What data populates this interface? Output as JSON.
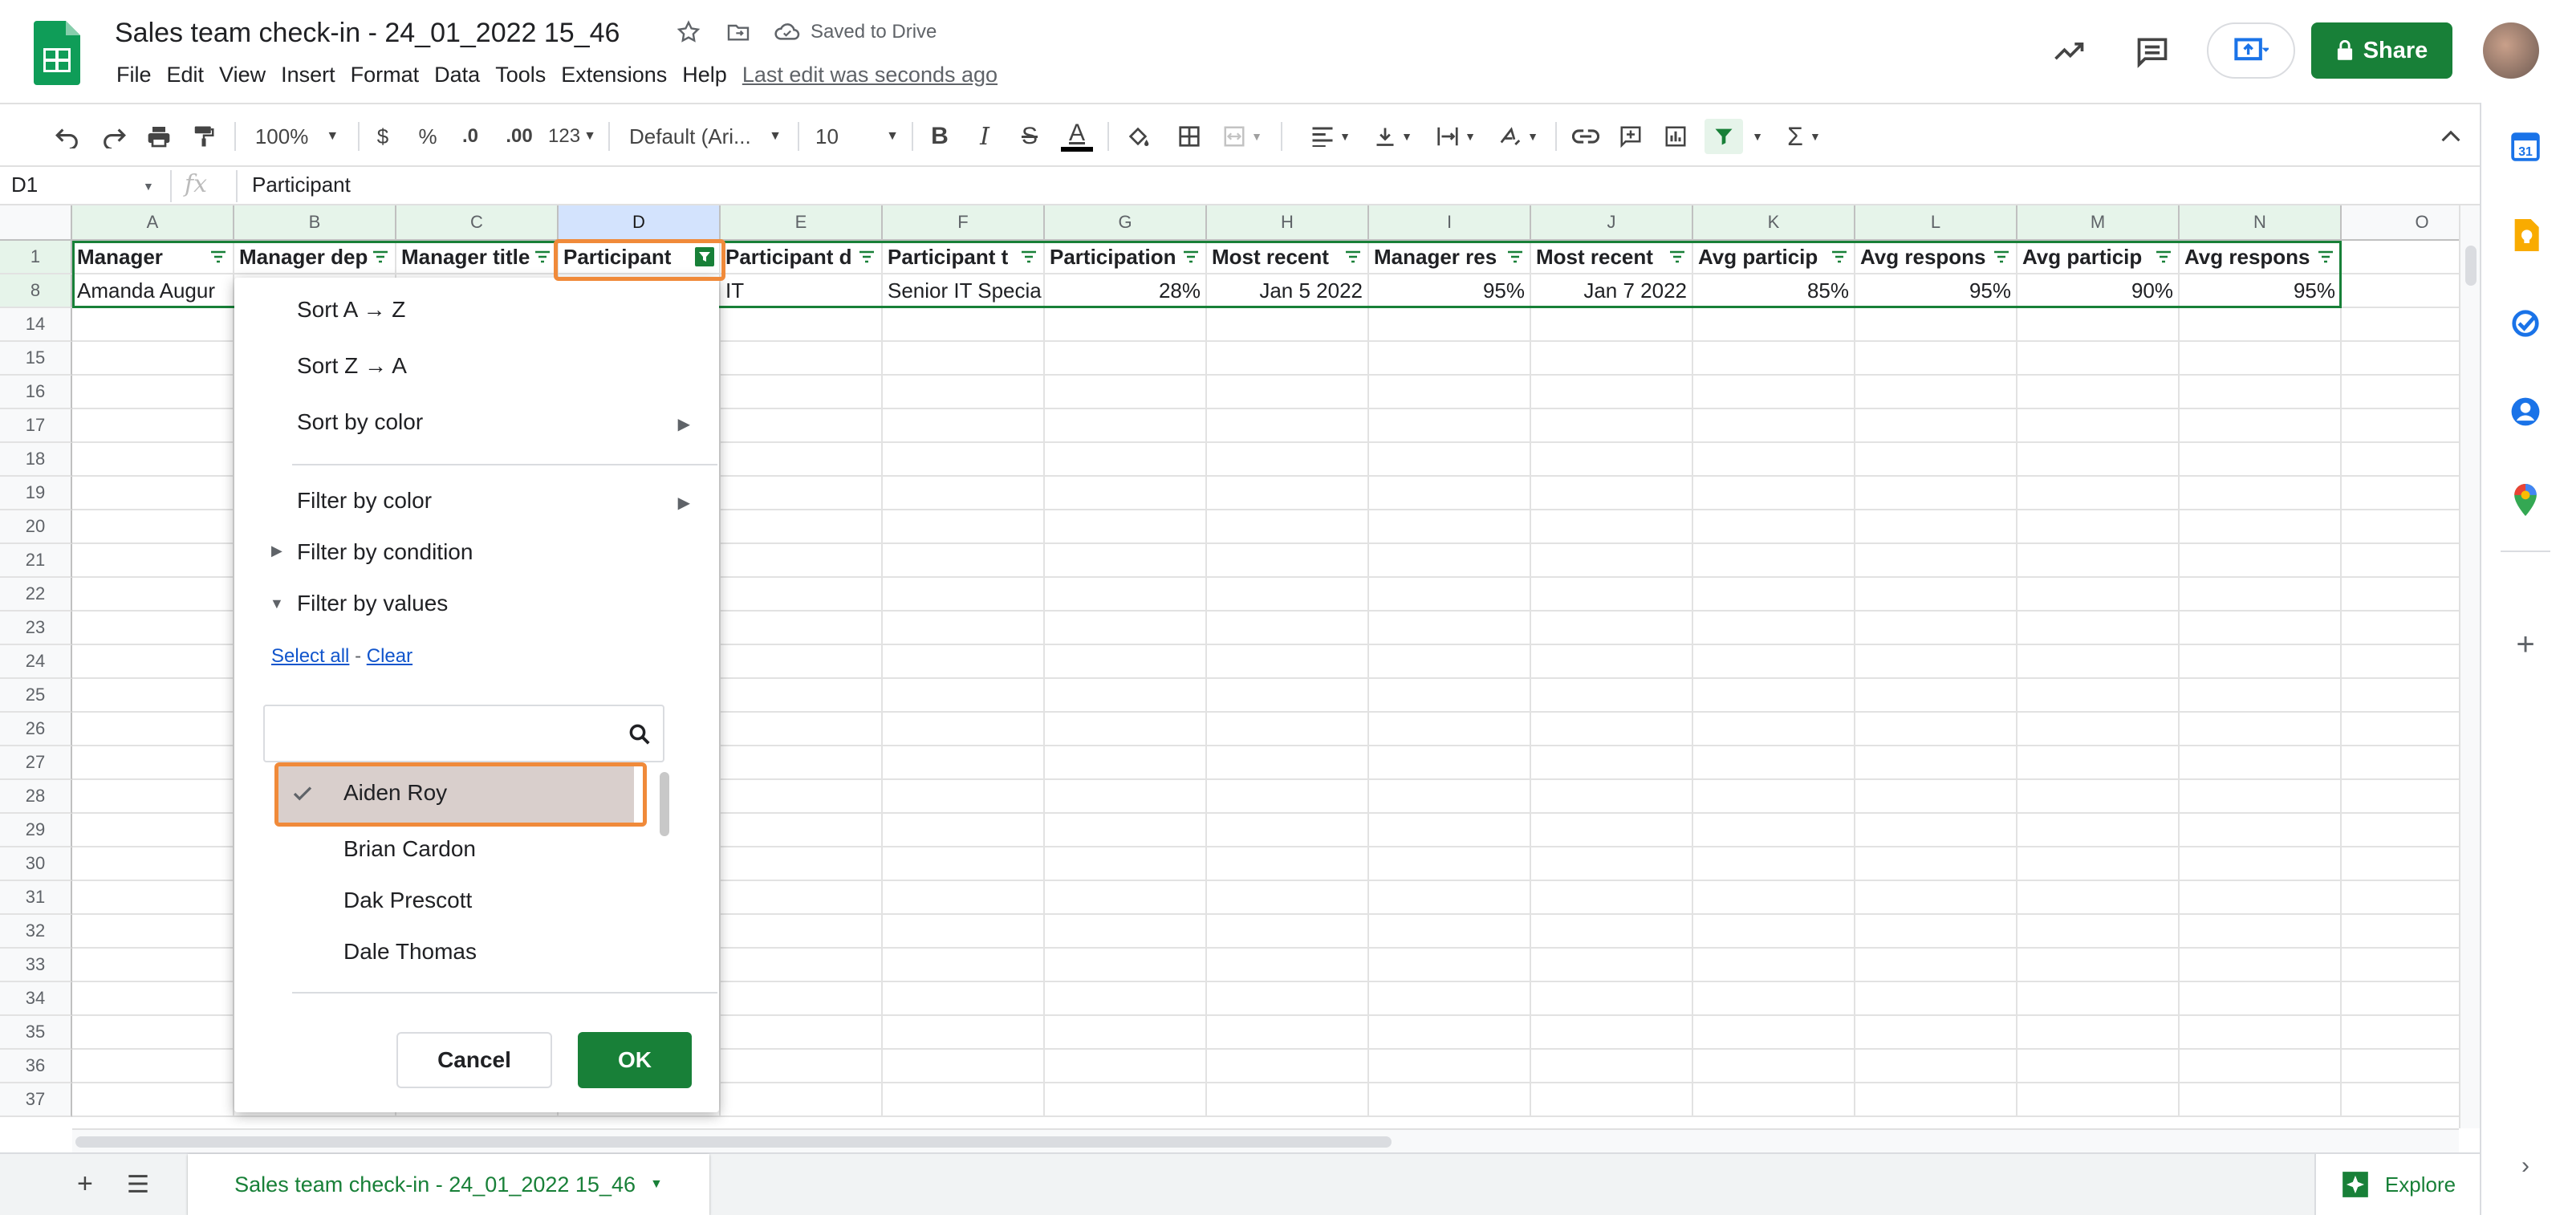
{
  "doc": {
    "title": "Sales team check-in - 24_01_2022 15_46",
    "saved": "Saved to Drive"
  },
  "menu": [
    "File",
    "Edit",
    "View",
    "Insert",
    "Format",
    "Data",
    "Tools",
    "Extensions",
    "Help"
  ],
  "last_edit": "Last edit was seconds ago",
  "share_label": "Share",
  "toolbar": {
    "zoom": "100%",
    "currency": "$",
    "percent": "%",
    "dec_less": ".0",
    "dec_more": ".00",
    "format": "123",
    "font": "Default (Ari...",
    "size": "10",
    "bold": "B",
    "italic": "I",
    "strike": "S",
    "textcolor": "A"
  },
  "formula": {
    "cell": "D1",
    "value": "Participant"
  },
  "columns": [
    "A",
    "B",
    "C",
    "D",
    "E",
    "F",
    "G",
    "H",
    "I",
    "J",
    "K",
    "L",
    "M",
    "N",
    "O"
  ],
  "header_row": [
    "Manager",
    "Manager dep",
    "Manager title",
    "Participant",
    "Participant d",
    "Participant t",
    "Participation",
    "Most recent",
    "Manager res",
    "Most recent",
    "Avg particip",
    "Avg respons",
    "Avg particip",
    "Avg respons"
  ],
  "data_row": [
    "Amanda Augur",
    "",
    "",
    "",
    "IT",
    "Senior IT Specia",
    "28%",
    "Jan 5 2022",
    "95%",
    "Jan 7 2022",
    "85%",
    "95%",
    "90%",
    "95%"
  ],
  "row_numbers": [
    "1",
    "8",
    "14",
    "15",
    "16",
    "17",
    "18",
    "19",
    "20",
    "21",
    "22",
    "23",
    "24",
    "25",
    "26",
    "27",
    "28",
    "29",
    "30",
    "31",
    "32",
    "33",
    "34",
    "35",
    "36",
    "37"
  ],
  "filter": {
    "sort_az": "Sort A → Z",
    "sort_za": "Sort Z → A",
    "sort_color": "Sort by color",
    "filter_color": "Filter by color",
    "filter_condition": "Filter by condition",
    "filter_values": "Filter by values",
    "select_all": "Select all",
    "dash": "-",
    "clear": "Clear",
    "values": [
      "Aiden Roy",
      "Brian Cardon",
      "Dak Prescott",
      "Dale Thomas"
    ],
    "cancel": "Cancel",
    "ok": "OK"
  },
  "sheet_tab": "Sales team check-in - 24_01_2022 15_46",
  "explore": "Explore",
  "colors": {
    "green": "#188038",
    "highlight": "#f08a3a",
    "selected_bg": "#d3e3fd"
  }
}
